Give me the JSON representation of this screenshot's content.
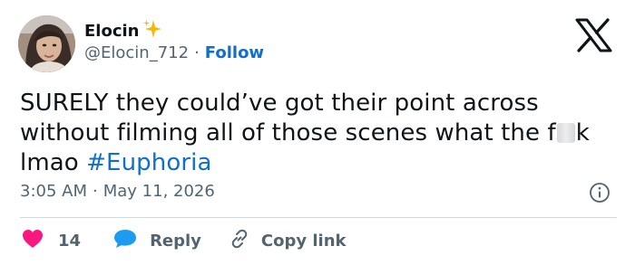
{
  "author": {
    "display_name": "Elocin",
    "handle": "@Elocin_712",
    "separator": "·",
    "follow_label": "Follow"
  },
  "tweet": {
    "text_part1": "SURELY they could’ve got their point across without filming all of those scenes what the f",
    "text_part2": "k lmao ",
    "hashtag": "#Euphoria"
  },
  "meta": {
    "time": "3:05 AM",
    "separator": "·",
    "date": "May 11, 2026"
  },
  "actions": {
    "like_count": "14",
    "reply_label": "Reply",
    "copy_link_label": "Copy link"
  },
  "colors": {
    "like": "#f91880",
    "reply": "#1d9bf0",
    "link": "#0f6fcc",
    "muted": "#536471",
    "sparkle": "#f5b700"
  },
  "icons": [
    "sparkle-icon",
    "x-logo-icon",
    "info-icon",
    "heart-icon",
    "reply-bubble-icon",
    "link-icon"
  ]
}
